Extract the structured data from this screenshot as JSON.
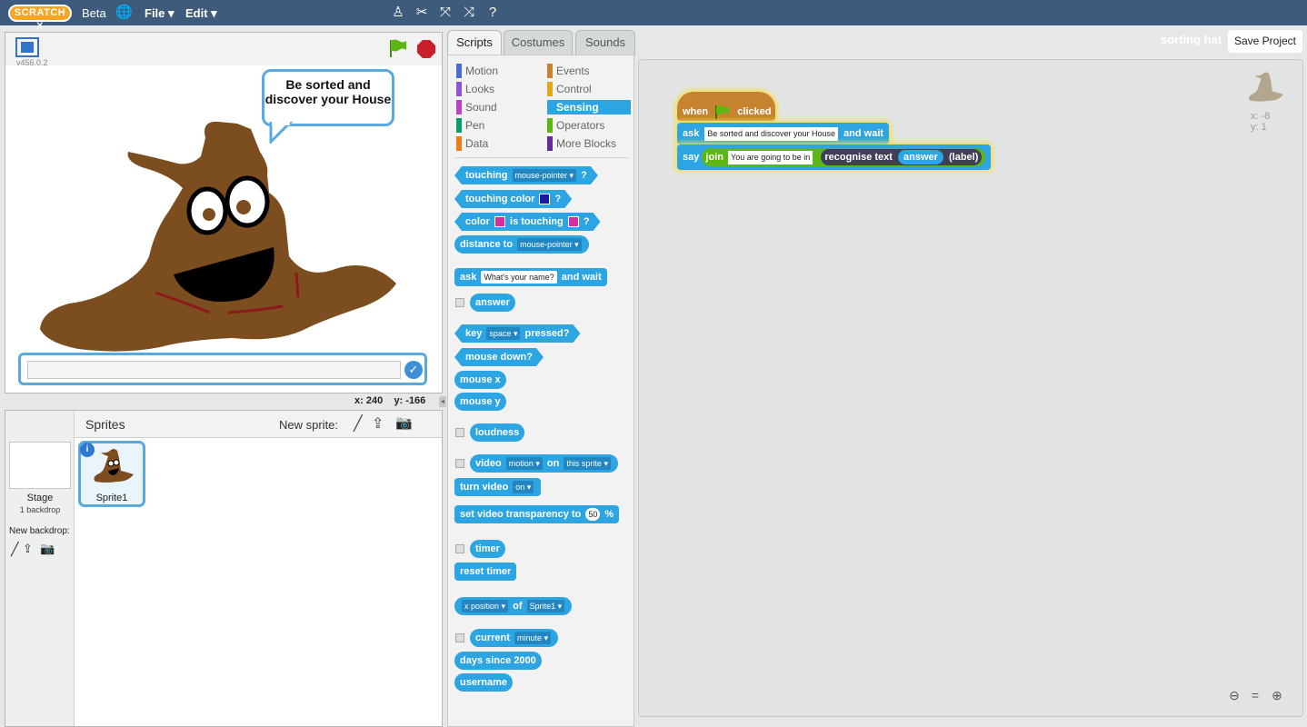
{
  "topbar": {
    "logo": "SCRATCH X",
    "beta": "Beta",
    "file_menu": "File ▾",
    "edit_menu": "Edit ▾"
  },
  "stage": {
    "version": "v456.0.2",
    "speech": "Be sorted and discover your House",
    "coords_x_label": "x:",
    "coords_x": "240",
    "coords_y_label": "y:",
    "coords_y": "-166"
  },
  "sprites": {
    "header": "Sprites",
    "new_sprite": "New sprite:",
    "stage_label": "Stage",
    "backdrop_count": "1 backdrop",
    "new_backdrop": "New backdrop:",
    "sprite1": "Sprite1"
  },
  "tabs": [
    "Scripts",
    "Costumes",
    "Sounds"
  ],
  "categories": [
    {
      "name": "Motion",
      "color": "#4a6cd4"
    },
    {
      "name": "Events",
      "color": "#c88330"
    },
    {
      "name": "Looks",
      "color": "#8a55d7"
    },
    {
      "name": "Control",
      "color": "#e1a91a"
    },
    {
      "name": "Sound",
      "color": "#bb42c3"
    },
    {
      "name": "Sensing",
      "color": "#2ca5e2"
    },
    {
      "name": "Pen",
      "color": "#0e9a6c"
    },
    {
      "name": "Operators",
      "color": "#5cb712"
    },
    {
      "name": "Data",
      "color": "#ee7d16"
    },
    {
      "name": "More Blocks",
      "color": "#632d99"
    }
  ],
  "palette": {
    "touching": "touching",
    "mouse_pointer": "mouse-pointer",
    "q": "?",
    "touching_color": "touching color",
    "color": "color",
    "is_touching": "is touching",
    "distance_to": "distance to",
    "ask": "ask",
    "ask_default": "What's your name?",
    "and_wait": "and wait",
    "answer": "answer",
    "key": "key",
    "space": "space",
    "pressed": "pressed?",
    "mouse_down": "mouse down?",
    "mouse_x": "mouse x",
    "mouse_y": "mouse y",
    "loudness": "loudness",
    "video": "video",
    "motion": "motion",
    "on": "on",
    "this_sprite": "this sprite",
    "turn_video": "turn video",
    "on_opt": "on",
    "set_video_transparency": "set video transparency to",
    "fifty": "50",
    "percent": "%",
    "timer": "timer",
    "reset_timer": "reset timer",
    "x_position": "x position",
    "of": "of",
    "sprite1": "Sprite1",
    "current": "current",
    "minute": "minute",
    "days_since": "days since 2000",
    "username": "username"
  },
  "scripts": {
    "project_title": "sorting hat",
    "save": "Save Project",
    "when": "when",
    "clicked": "clicked",
    "ask": "ask",
    "ask_text": "Be sorted and discover your House",
    "and_wait": "and wait",
    "say": "say",
    "join": "join",
    "join_text": "You are going to be in",
    "recognise": "recognise text",
    "answer": "answer",
    "label": "(label)",
    "sprite_x": "x: -8",
    "sprite_y": "y: 1"
  }
}
